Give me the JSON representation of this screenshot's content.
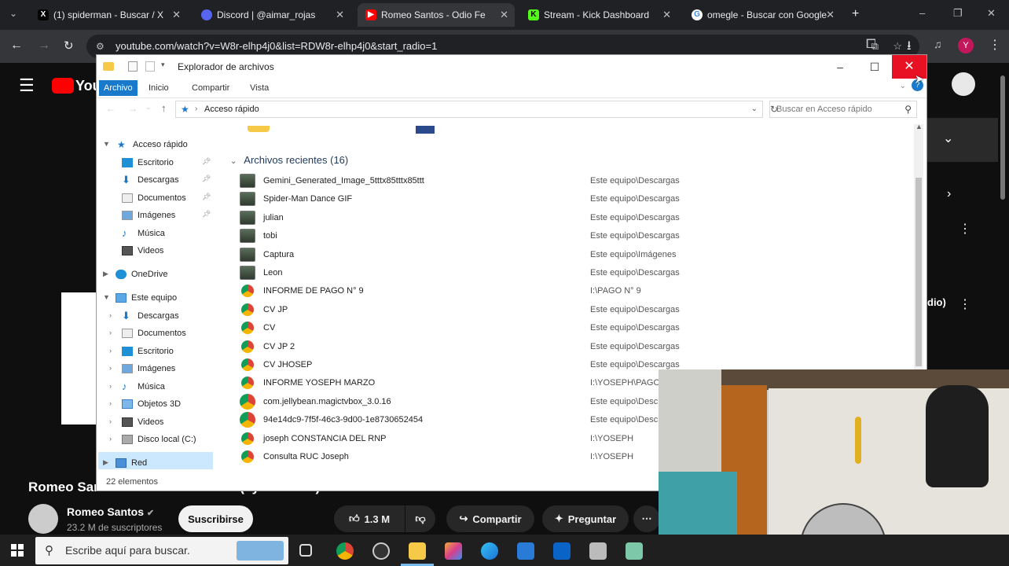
{
  "browser": {
    "tabs": [
      {
        "label": "(1) spiderman - Buscar / X",
        "icon": "x-logo-icon"
      },
      {
        "label": "Discord | @aimar_rojas",
        "icon": "discord-icon"
      },
      {
        "label": "Romeo Santos - Odio Fe",
        "icon": "youtube-icon"
      },
      {
        "label": "Stream - Kick Dashboard",
        "icon": "kick-icon"
      },
      {
        "label": "omegle - Buscar con Google",
        "icon": "google-icon"
      }
    ],
    "url": "youtube.com/watch?v=W8r-elhp4j0&list=RDW8r-elhp4j0&start_radio=1",
    "profile_initial": "Y"
  },
  "youtube": {
    "logo": "You",
    "video_title": "Romeo Santos - Odio feat. Drake (Lyric Video)",
    "channel": "Romeo Santos",
    "subscribers": "23.2 M de suscriptores",
    "subscribe_label": "Suscribirse",
    "likes": "1.3 M",
    "share_label": "Compartir",
    "ask_label": "Preguntar",
    "side_label": "dio)"
  },
  "explorer": {
    "title": "Explorador de archivos",
    "ribbon": [
      "Archivo",
      "Inicio",
      "Compartir",
      "Vista"
    ],
    "address": "Acceso rápido",
    "search_placeholder": "Buscar en Acceso rápido",
    "nav": {
      "quick_access": "Acceso rápido",
      "quick_items": [
        "Escritorio",
        "Descargas",
        "Documentos",
        "Imágenes",
        "Música",
        "Videos"
      ],
      "onedrive": "OneDrive",
      "this_pc": "Este equipo",
      "pc_items": [
        "Descargas",
        "Documentos",
        "Escritorio",
        "Imágenes",
        "Música",
        "Objetos 3D",
        "Videos",
        "Disco local (C:)"
      ],
      "network": "Red"
    },
    "group_header": "Archivos recientes (16)",
    "files": [
      {
        "name": "Gemini_Generated_Image_5tttx85tttx85ttt",
        "location": "Este equipo\\Descargas",
        "type": "image"
      },
      {
        "name": "Spider-Man Dance GIF",
        "location": "Este equipo\\Descargas",
        "type": "image"
      },
      {
        "name": "julian",
        "location": "Este equipo\\Descargas",
        "type": "image"
      },
      {
        "name": "tobi",
        "location": "Este equipo\\Descargas",
        "type": "image"
      },
      {
        "name": "Captura",
        "location": "Este equipo\\Imágenes",
        "type": "image"
      },
      {
        "name": "Leon",
        "location": "Este equipo\\Descargas",
        "type": "image"
      },
      {
        "name": "INFORME DE PAGO N° 9",
        "location": "I:\\PAGO N° 9",
        "type": "chrome"
      },
      {
        "name": "CV JP",
        "location": "Este equipo\\Descargas",
        "type": "chrome"
      },
      {
        "name": "CV",
        "location": "Este equipo\\Descargas",
        "type": "chrome"
      },
      {
        "name": "CV JP 2",
        "location": "Este equipo\\Descargas",
        "type": "chrome"
      },
      {
        "name": "CV JHOSEP",
        "location": "Este equipo\\Descargas",
        "type": "chrome"
      },
      {
        "name": "INFORME YOSEPH MARZO",
        "location": "I:\\YOSEPH\\PAGO",
        "type": "chrome"
      },
      {
        "name": "com.jellybean.magictvbox_3.0.16",
        "location": "Este equipo\\Desc",
        "type": "chromebig"
      },
      {
        "name": "94e14dc9-7f5f-46c3-9d00-1e8730652454",
        "location": "Este equipo\\Desc",
        "type": "chromebig"
      },
      {
        "name": "joseph CONSTANCIA DEL RNP",
        "location": "I:\\YOSEPH",
        "type": "chrome"
      },
      {
        "name": "Consulta RUC Joseph",
        "location": "I:\\YOSEPH",
        "type": "chrome"
      }
    ],
    "status": "22 elementos"
  },
  "taskbar": {
    "search_placeholder": "Escribe aquí para buscar."
  },
  "colors": {
    "accent": "#1979ca",
    "close": "#e81123",
    "yt_red": "#ff0000"
  }
}
